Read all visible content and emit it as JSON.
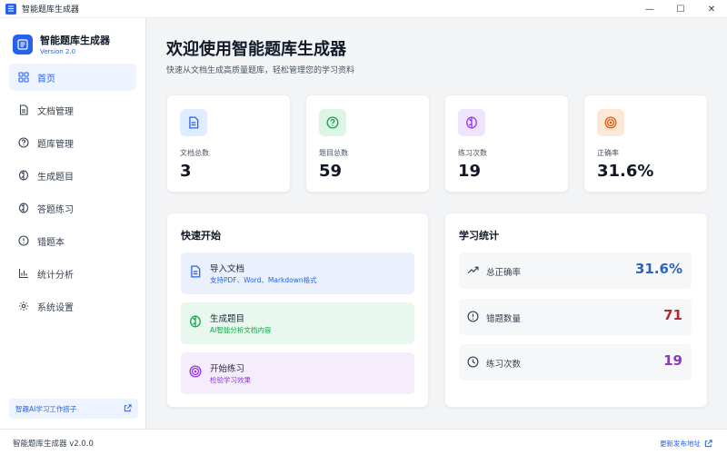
{
  "window": {
    "title": "智能题库生成器",
    "minimize": "—",
    "maximize": "☐",
    "close": "✕"
  },
  "brand": {
    "title": "智能题库生成器",
    "version": "Version 2.0"
  },
  "sidebar": {
    "items": [
      {
        "label": "首页",
        "icon": "home-grid-icon"
      },
      {
        "label": "文档管理",
        "icon": "document-icon"
      },
      {
        "label": "题库管理",
        "icon": "question-circle-icon"
      },
      {
        "label": "生成题目",
        "icon": "brain-icon"
      },
      {
        "label": "答题练习",
        "icon": "brain-icon"
      },
      {
        "label": "错题本",
        "icon": "alert-circle-icon"
      },
      {
        "label": "统计分析",
        "icon": "bar-chart-icon"
      },
      {
        "label": "系统设置",
        "icon": "gear-icon"
      }
    ],
    "promo": "智趣AI学习工作搭子"
  },
  "main": {
    "title": "欢迎使用智能题库生成器",
    "subtitle": "快速从文档生成高质量题库，轻松管理您的学习资料"
  },
  "stats": [
    {
      "label": "文档总数",
      "value": "3",
      "icon": "document-icon",
      "bg": "#e0ecff",
      "color": "#2563eb"
    },
    {
      "label": "题目总数",
      "value": "59",
      "icon": "question-circle-icon",
      "bg": "#dcf5e6",
      "color": "#16a34a"
    },
    {
      "label": "练习次数",
      "value": "19",
      "icon": "brain-icon",
      "bg": "#efe4fb",
      "color": "#9333ea"
    },
    {
      "label": "正确率",
      "value": "31.6%",
      "icon": "target-icon",
      "bg": "#fde8d7",
      "color": "#ea580c"
    }
  ],
  "quickstart": {
    "title": "快速开始",
    "items": [
      {
        "title": "导入文档",
        "desc": "支持PDF、Word、Markdown格式",
        "bg": "#eaf1fd",
        "color": "#2563eb"
      },
      {
        "title": "生成题目",
        "desc": "AI智能分析文档内容",
        "bg": "#e8f8ee",
        "color": "#16a34a"
      },
      {
        "title": "开始练习",
        "desc": "检验学习效果",
        "bg": "#f5ecfc",
        "color": "#9333ea"
      }
    ]
  },
  "learning": {
    "title": "学习统计",
    "rows": [
      {
        "label": "总正确率",
        "value": "31.6%",
        "icon": "trend-up-icon",
        "color": "#2b66b8"
      },
      {
        "label": "错题数量",
        "value": "71",
        "icon": "alert-circle-icon",
        "color": "#b42a34"
      },
      {
        "label": "练习次数",
        "value": "19",
        "icon": "clock-icon",
        "color": "#8a3bb5"
      }
    ]
  },
  "footer": {
    "left": "智能题库生成器 v2.0.0",
    "right": "更新发布地址"
  }
}
